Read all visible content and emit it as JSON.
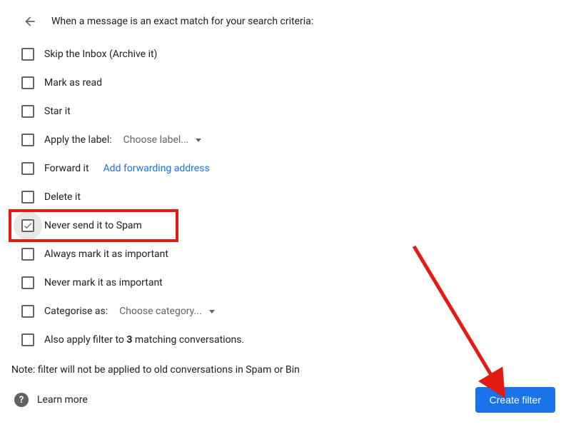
{
  "header": {
    "title": "When a message is an exact match for your search criteria:"
  },
  "options": {
    "skip_inbox": "Skip the Inbox (Archive it)",
    "mark_read": "Mark as read",
    "star": "Star it",
    "apply_label": "Apply the label:",
    "choose_label": "Choose label...",
    "forward": "Forward it",
    "add_forwarding": "Add forwarding address",
    "delete": "Delete it",
    "never_spam": "Never send it to Spam",
    "always_important": "Always mark it as important",
    "never_important": "Never mark it as important",
    "categorise": "Categorise as:",
    "choose_category": "Choose category...",
    "also_apply_prefix": "Also apply filter to ",
    "also_apply_count": "3",
    "also_apply_suffix": " matching conversations."
  },
  "footer": {
    "note": "Note: filter will not be applied to old conversations in Spam or Bin",
    "learn_more": "Learn more",
    "create_filter": "Create filter"
  },
  "annotation": {
    "highlight_color": "#e41b13"
  }
}
